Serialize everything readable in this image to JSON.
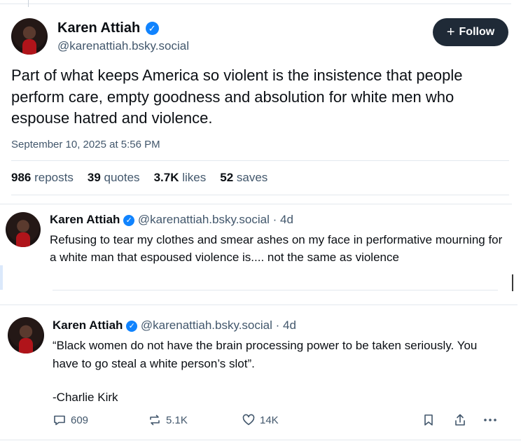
{
  "main_post": {
    "author_name": "Karen Attiah",
    "handle": "@karenattiah.bsky.social",
    "follow_label": "Follow",
    "follow_plus": "+",
    "text": "Part of what keeps America so violent is the insistence that people perform care, empty goodness and absolution for white men who espouse hatred and  violence.",
    "timestamp": "September 10, 2025 at 5:56 PM",
    "stats": [
      {
        "num": "986",
        "label": "reposts"
      },
      {
        "num": "39",
        "label": "quotes"
      },
      {
        "num": "3.7K",
        "label": "likes"
      },
      {
        "num": "52",
        "label": "saves"
      }
    ]
  },
  "reply1": {
    "author_name": "Karen Attiah",
    "handle_time": "@karenattiah.bsky.social · 4d",
    "text": "Refusing to tear my clothes and smear ashes on my face in performative mourning  for a white man that espoused violence is.... not the same as violence"
  },
  "reply2": {
    "author_name": "Karen Attiah",
    "handle_time": "@karenattiah.bsky.social · 4d",
    "text_line1": "“Black women do not have the brain processing power to be taken seriously. You have to go steal a white person’s slot”.",
    "text_line2": "-Charlie Kirk",
    "actions": {
      "replies": "609",
      "reposts": "5.1K",
      "likes": "14K"
    }
  },
  "colors": {
    "accent": "#1083fe",
    "follow_bg": "#1f2a37",
    "muted": "#42576c"
  }
}
